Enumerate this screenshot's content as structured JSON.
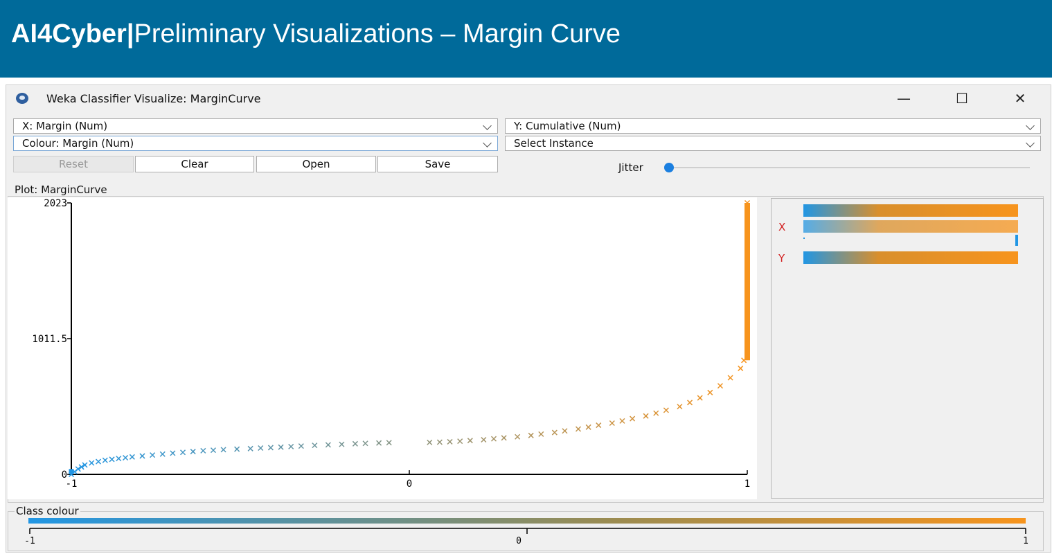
{
  "banner": {
    "bold": "AI4Cyber|",
    "title": "Preliminary Visualizations – Margin Curve"
  },
  "window": {
    "title": "Weka Classifier Visualize: MarginCurve",
    "controls": {
      "minimize": "—",
      "maximize": "☐",
      "close": "✕"
    }
  },
  "selectors": {
    "x_axis": "X: Margin (Num)",
    "y_axis": "Y: Cumulative (Num)",
    "colour": "Colour: Margin (Num)",
    "instance": "Select Instance"
  },
  "buttons": {
    "reset": "Reset",
    "clear": "Clear",
    "open": "Open",
    "save": "Save"
  },
  "jitter": {
    "label": "Jitter",
    "value": 0
  },
  "plot": {
    "title": "Plot: MarginCurve"
  },
  "side_panel": {
    "x_label": "X",
    "y_label": "Y"
  },
  "class_colour": {
    "title": "Class colour",
    "ticks": [
      "-1",
      "0",
      "1"
    ]
  },
  "icons": [
    "weka-icon",
    "minimize-icon",
    "maximize-icon",
    "close-icon",
    "chevron-down-icon"
  ],
  "colors": {
    "banner": "#006a9a",
    "low": "#2196e4",
    "high": "#f7941d",
    "jitter_thumb": "#1b7fe0"
  },
  "chart_data": {
    "type": "scatter",
    "marker": "x",
    "title": "",
    "xlabel": "Margin",
    "ylabel": "Cumulative",
    "xlim": [
      -1,
      1
    ],
    "ylim": [
      0,
      2023
    ],
    "x_ticks": [
      "-1",
      "0",
      "1"
    ],
    "y_ticks": [
      "2023",
      "1011.5",
      "0"
    ],
    "colour_by": "Margin",
    "colour_range": [
      "#2196e4",
      "#f7941d"
    ],
    "series": [
      {
        "points": [
          [
            -1.0,
            0
          ],
          [
            -0.99,
            20
          ],
          [
            -0.98,
            40
          ],
          [
            -0.97,
            55
          ],
          [
            -0.96,
            70
          ],
          [
            -0.94,
            85
          ],
          [
            -0.92,
            95
          ],
          [
            -0.9,
            105
          ],
          [
            -0.88,
            112
          ],
          [
            -0.86,
            118
          ],
          [
            -0.84,
            124
          ],
          [
            -0.82,
            130
          ],
          [
            -0.79,
            137
          ],
          [
            -0.76,
            144
          ],
          [
            -0.73,
            151
          ],
          [
            -0.7,
            158
          ],
          [
            -0.67,
            164
          ],
          [
            -0.64,
            170
          ],
          [
            -0.61,
            176
          ],
          [
            -0.58,
            180
          ],
          [
            -0.55,
            184
          ],
          [
            -0.51,
            188
          ],
          [
            -0.47,
            192
          ],
          [
            -0.44,
            196
          ],
          [
            -0.41,
            199
          ],
          [
            -0.38,
            203
          ],
          [
            -0.35,
            207
          ],
          [
            -0.32,
            211
          ],
          [
            -0.28,
            216
          ],
          [
            -0.24,
            220
          ],
          [
            -0.2,
            224
          ],
          [
            -0.16,
            228
          ],
          [
            -0.13,
            231
          ],
          [
            -0.09,
            234
          ],
          [
            -0.06,
            236
          ],
          [
            0.06,
            238
          ],
          [
            0.09,
            240
          ],
          [
            0.12,
            243
          ],
          [
            0.15,
            247
          ],
          [
            0.18,
            252
          ],
          [
            0.22,
            258
          ],
          [
            0.25,
            265
          ],
          [
            0.28,
            272
          ],
          [
            0.32,
            280
          ],
          [
            0.36,
            290
          ],
          [
            0.39,
            300
          ],
          [
            0.43,
            312
          ],
          [
            0.46,
            324
          ],
          [
            0.5,
            338
          ],
          [
            0.53,
            352
          ],
          [
            0.56,
            366
          ],
          [
            0.6,
            382
          ],
          [
            0.63,
            398
          ],
          [
            0.66,
            415
          ],
          [
            0.7,
            435
          ],
          [
            0.73,
            456
          ],
          [
            0.76,
            478
          ],
          [
            0.8,
            505
          ],
          [
            0.83,
            535
          ],
          [
            0.86,
            570
          ],
          [
            0.89,
            610
          ],
          [
            0.92,
            660
          ],
          [
            0.95,
            720
          ],
          [
            0.98,
            790
          ],
          [
            0.99,
            850
          ],
          [
            1.0,
            2023
          ]
        ]
      }
    ]
  }
}
